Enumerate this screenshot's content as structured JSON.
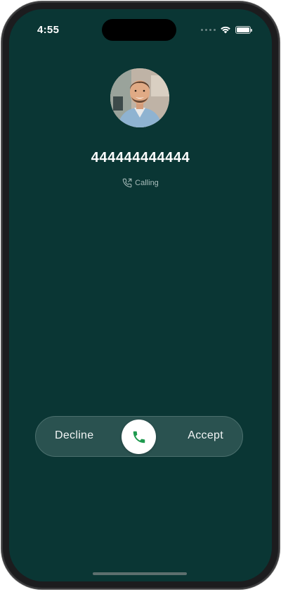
{
  "status_bar": {
    "time": "4:55",
    "wifi_icon": "wifi-icon",
    "battery_icon": "battery-icon"
  },
  "caller": {
    "number": "444444444444",
    "status": "Calling",
    "avatar": "caller-photo"
  },
  "call_actions": {
    "decline_label": "Decline",
    "accept_label": "Accept",
    "knob_icon": "phone-icon"
  },
  "colors": {
    "background": "#0a3634",
    "slider": "#2a5250",
    "accept_icon": "#1f9a4f"
  }
}
